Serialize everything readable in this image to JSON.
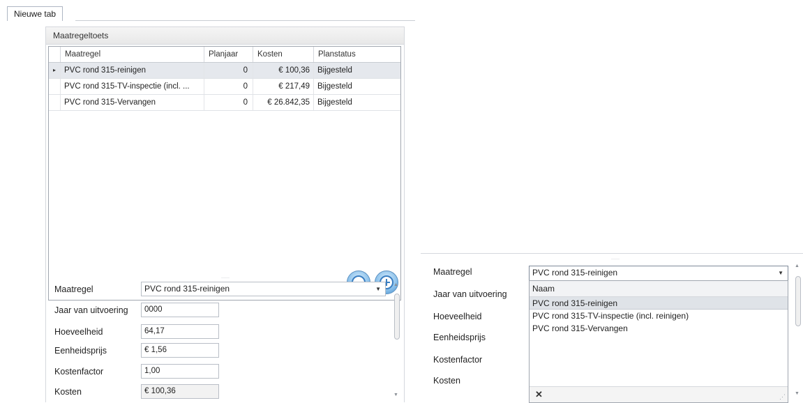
{
  "tabs": {
    "active_label": "Nieuwe tab"
  },
  "panel": {
    "title": "Maatregeltoets",
    "grid": {
      "columns": [
        "Maatregel",
        "Planjaar",
        "Kosten",
        "Planstatus"
      ],
      "rows": [
        {
          "indicator": "▸",
          "maatregel": "PVC rond 315-reinigen",
          "planjaar": "0",
          "kosten": "€ 100,36",
          "planstatus": "Bijgesteld",
          "selected": true
        },
        {
          "indicator": "",
          "maatregel": "PVC rond 315-TV-inspectie (incl. ...",
          "planjaar": "0",
          "kosten": "€ 217,49",
          "planstatus": "Bijgesteld",
          "selected": false
        },
        {
          "indicator": "",
          "maatregel": "PVC rond 315-Vervangen",
          "planjaar": "0",
          "kosten": "€ 26.842,35",
          "planstatus": "Bijgesteld",
          "selected": false
        }
      ]
    },
    "buttons": {
      "remove_icon": "minus-circle-icon",
      "add_icon": "plus-circle-icon"
    },
    "form": {
      "maatregel_label": "Maatregel",
      "maatregel_value": "PVC rond 315-reinigen",
      "jaar_label": "Jaar van uitvoering",
      "jaar_value": "0000",
      "hoeveelheid_label": "Hoeveelheid",
      "hoeveelheid_value": "64,17",
      "eenheidsprijs_label": "Eenheidsprijs",
      "eenheidsprijs_value": "€ 1,56",
      "kostenfactor_label": "Kostenfactor",
      "kostenfactor_value": "1,00",
      "kosten_label": "Kosten",
      "kosten_value": "€ 100,36"
    }
  },
  "right_panel": {
    "form": {
      "maatregel_label": "Maatregel",
      "maatregel_value": "PVC rond 315-reinigen",
      "jaar_label": "Jaar van uitvoering",
      "hoeveelheid_label": "Hoeveelheid",
      "eenheidsprijs_label": "Eenheidsprijs",
      "kostenfactor_label": "Kostenfactor",
      "kosten_label": "Kosten"
    },
    "dropdown": {
      "header": "Naam",
      "items": [
        "PVC rond 315-reinigen",
        "PVC rond 315-TV-inspectie (incl. reinigen)",
        "PVC rond 315-Vervangen"
      ],
      "selected_index": 0,
      "close_glyph": "✕"
    }
  },
  "colors": {
    "accent": "#3a7ec2",
    "selection": "#e5e8ed",
    "border": "#a0a6af"
  }
}
